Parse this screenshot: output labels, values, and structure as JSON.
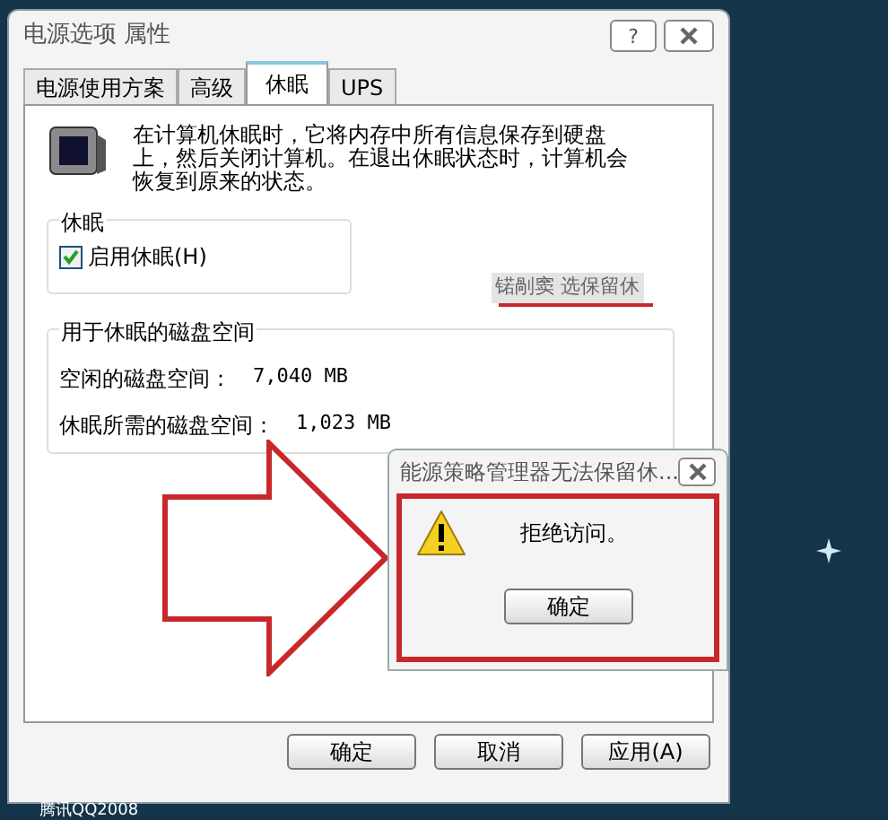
{
  "window": {
    "title": "电源选项 属性",
    "help": "?"
  },
  "tabs": [
    {
      "label": "电源使用方案",
      "selected": false
    },
    {
      "label": "高级",
      "selected": false
    },
    {
      "label": "休眠",
      "selected": true
    },
    {
      "label": "UPS",
      "selected": false
    }
  ],
  "description": "在计算机休眠时，它将内存中所有信息保存到硬盘上，然后关闭计算机。在退出休眠状态时，计算机会恢复到原来的状态。",
  "hibernate_group": {
    "title": "休眠",
    "checkbox": {
      "label": "启用休眠(H)",
      "checked": true
    }
  },
  "garbled_text": "锘剮窦 选保留休",
  "disk_group": {
    "title": "用于休眠的磁盘空间",
    "rows": [
      {
        "label": "空闲的磁盘空间：",
        "value": "7,040 MB"
      },
      {
        "label": "休眠所需的磁盘空间：",
        "value": "1,023 MB"
      }
    ]
  },
  "buttons": [
    "确定",
    "取消",
    "应用(A)"
  ],
  "message_box": {
    "title": "能源策略管理器无法保留休...",
    "message": "拒绝访问。",
    "button": "确定"
  },
  "desktop_label": "腾讯QQ2008"
}
